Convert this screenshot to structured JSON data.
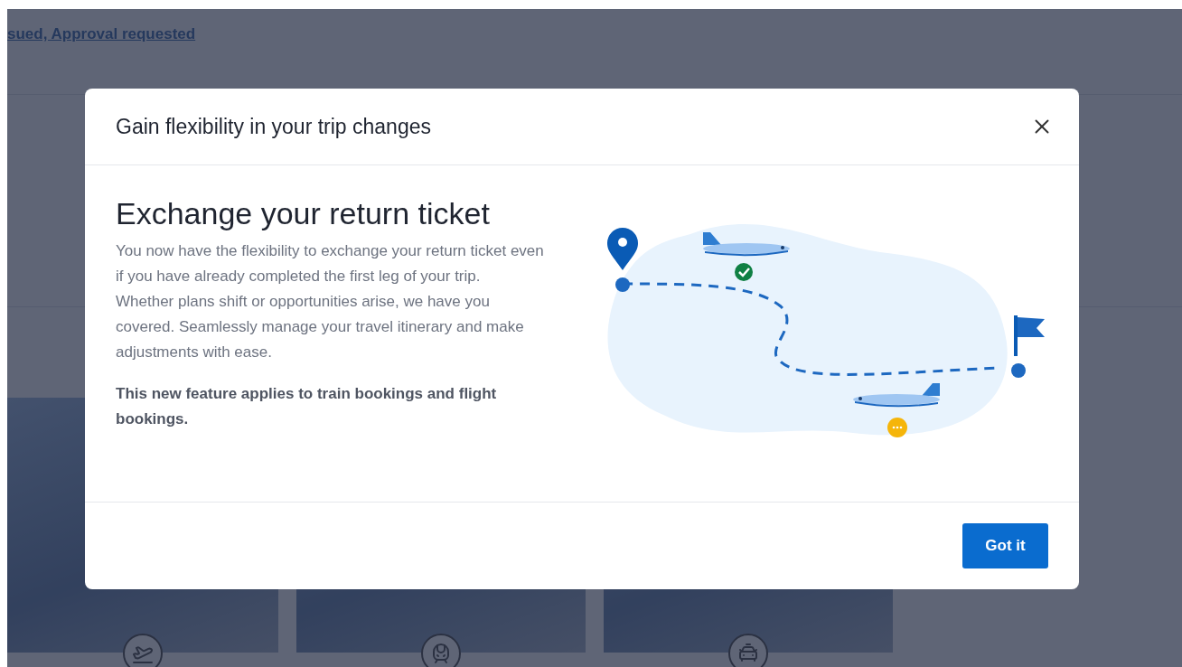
{
  "background": {
    "link": "sued, Approval requested",
    "cards": [
      {
        "kind": "flight"
      },
      {
        "kind": "train"
      },
      {
        "kind": "car"
      }
    ]
  },
  "modal": {
    "title": "Gain flexibility in your trip changes",
    "heading": "Exchange your return ticket",
    "paragraphs": [
      "You now have the flexibility to exchange your return ticket even if you have already completed the first leg of your trip.",
      "Whether plans shift or opportunities arise, we have you covered. Seamlessly manage your travel itinerary and make adjustments with ease."
    ],
    "note": "This new feature applies to train bookings and flight bookings.",
    "button": "Got it"
  }
}
